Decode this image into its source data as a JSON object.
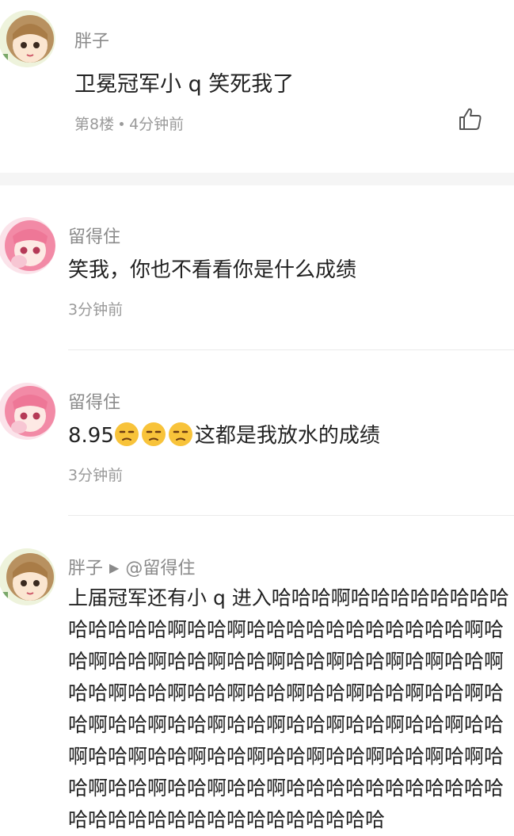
{
  "colors": {
    "text": "#222222",
    "muted": "#9a9a9a",
    "divider": "#ebebeb",
    "band": "#f5f5f5"
  },
  "main_comment": {
    "username": "胖子",
    "content": "卫冕冠军小 q 笑死我了",
    "floor": "第8楼",
    "time": "4分钟前",
    "like_icon": "thumbs-up-icon"
  },
  "replies": [
    {
      "username": "留得住",
      "content": "笑我，你也不看看你是什么成绩",
      "time": "3分钟前"
    },
    {
      "username": "留得住",
      "content_prefix": "8.95",
      "emoji": "unamused-face-icon",
      "emoji_count": 3,
      "content_suffix": "这都是我放水的成绩",
      "time": "3分钟前"
    },
    {
      "username": "胖子",
      "reply_to": "@留得住",
      "reply_arrow": "▶",
      "content": "上届冠军还有小 q 进入哈哈哈啊哈哈哈哈哈哈哈哈哈哈哈哈哈啊哈哈啊哈哈哈哈哈哈哈哈哈哈哈啊哈哈啊哈哈啊哈哈啊哈哈啊哈哈啊哈哈啊哈啊哈哈啊哈哈啊哈哈啊哈哈啊哈哈啊哈哈啊哈哈啊哈哈啊哈哈啊哈哈啊哈哈啊哈哈啊哈哈啊哈哈啊哈哈啊哈哈啊哈哈啊哈哈啊哈哈啊哈哈啊哈哈啊哈哈啊哈啊哈哈啊哈哈啊哈哈啊哈哈啊哈哈哈哈哈哈哈哈哈哈哈哈哈哈哈哈哈哈哈哈哈哈哈哈哈哈哈"
    }
  ]
}
